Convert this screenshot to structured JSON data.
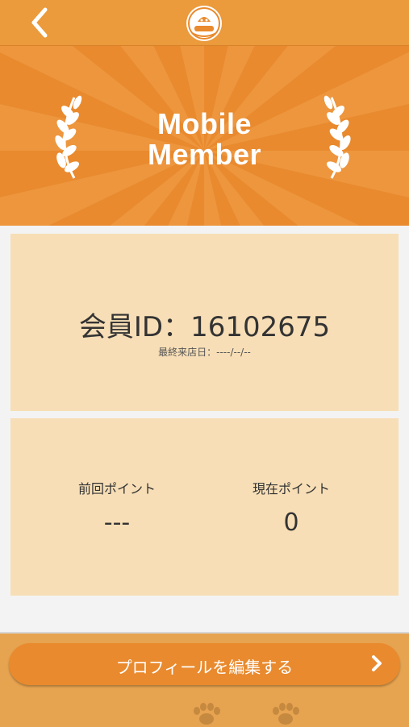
{
  "header": {
    "back_icon": "chevron-left-icon",
    "logo_icon": "bakery-logo-icon"
  },
  "hero": {
    "title_line1": "Mobile",
    "title_line2": "Member",
    "decor_icon": "laurel-branch-icon"
  },
  "member": {
    "id_text": "会員ID：16102675",
    "last_visit_text": "最終来店日：----/--/--"
  },
  "points": {
    "previous_label": "前回ポイント",
    "previous_value": "---",
    "current_label": "現在ポイント",
    "current_value": "0"
  },
  "footer": {
    "edit_profile_label": "プロフィールを編集する",
    "edit_icon": "chevron-right-icon",
    "decor_icon": "paw-print-icon"
  },
  "colors": {
    "accent": "#e98a2e",
    "header": "#eb9a3c",
    "card": "#f7deb6",
    "footer": "#e6a350"
  }
}
